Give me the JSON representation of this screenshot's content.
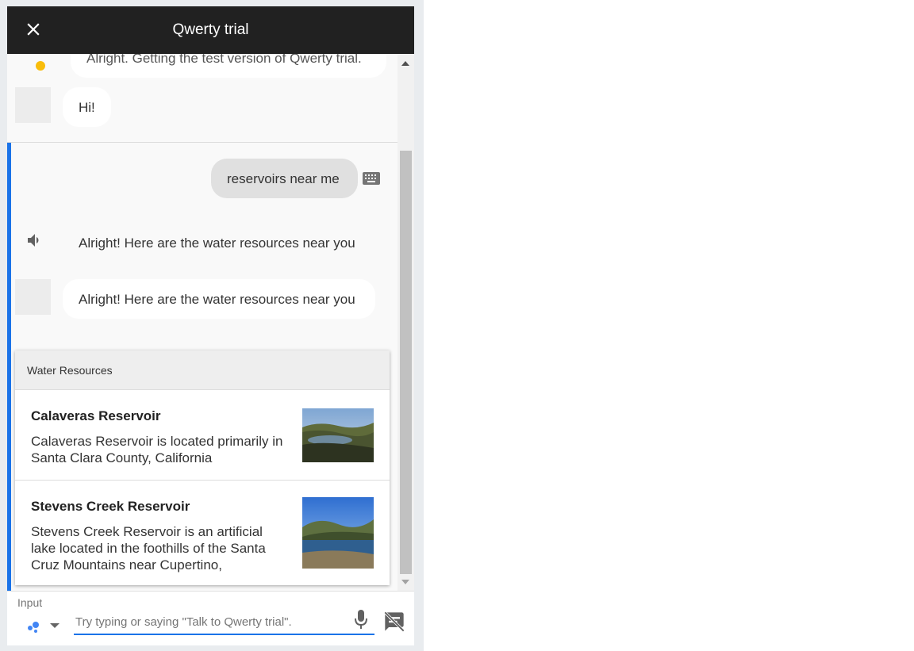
{
  "header": {
    "title": "Qwerty trial",
    "close_icon": "close-icon"
  },
  "chat": {
    "previous_message": "Alright. Getting the test version of Qwerty trial.",
    "greeting": "Hi!",
    "user_query": "reservoirs near me",
    "speech_response": "Alright! Here are the water resources near you",
    "text_response": "Alright! Here are the water resources near you",
    "icons": {
      "keyboard": "keyboard-icon",
      "speaker": "speaker-icon"
    }
  },
  "card": {
    "title": "Water Resources",
    "items": [
      {
        "title": "Calaveras Reservoir",
        "description": "Calaveras Reservoir is located primarily in Santa Clara County, California"
      },
      {
        "title": "Stevens Creek Reservoir",
        "description": "Stevens Creek Reservoir is an artificial lake located in the foothills of the Santa Cruz Mountains near Cupertino,"
      }
    ]
  },
  "input": {
    "label": "Input",
    "placeholder": "Try typing or saying \"Talk to Qwerty trial\".",
    "value": "",
    "icons": {
      "assistant": "assistant-icon",
      "mic": "mic-icon",
      "chat_off": "chat-off-icon"
    }
  },
  "colors": {
    "header_bg": "#212121",
    "accent": "#1a73e8",
    "assistant_yellow": "#f9bd0b",
    "chat_bg": "#f9f9f9"
  }
}
